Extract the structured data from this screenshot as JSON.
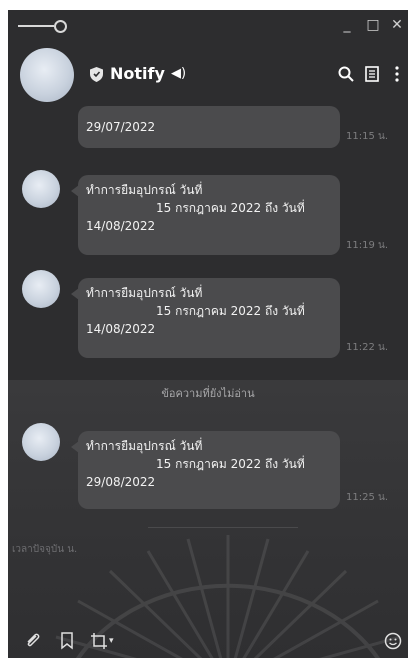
{
  "window": {
    "restore_label": "□",
    "close_label": "✕",
    "minimize_label": "_"
  },
  "header": {
    "title": "Notify",
    "speaker": "◀)"
  },
  "messages": [
    {
      "text_line1": "",
      "text_line2": "",
      "text_line3": "29/07/2022",
      "time": "11:15 น."
    },
    {
      "text_line1": "ทำการยืมอุปกรณ์ วันที่",
      "text_line2": "15 กรกฎาคม 2022 ถึง วันที่",
      "text_line3": "14/08/2022",
      "time": "11:19 น."
    },
    {
      "text_line1": "ทำการยืมอุปกรณ์ วันที่",
      "text_line2": "15 กรกฎาคม 2022 ถึง วันที่",
      "text_line3": "14/08/2022",
      "time": "11:22 น."
    },
    {
      "text_line1": "ทำการยืมอุปกรณ์ วันที่",
      "text_line2": "15 กรกฎาคม 2022 ถึง วันที่",
      "text_line3": "29/08/2022",
      "time": "11:25 น."
    }
  ],
  "unread_label": "ข้อความที่ยังไม่อ่าน",
  "seen_label": "เวลาปัจจุบัน น.",
  "bottom": {
    "dropdown_arrow": "▾"
  },
  "colors": {
    "background": "#2d2d2f",
    "bubble": "#4b4b4d",
    "text": "#f2f2f2"
  }
}
